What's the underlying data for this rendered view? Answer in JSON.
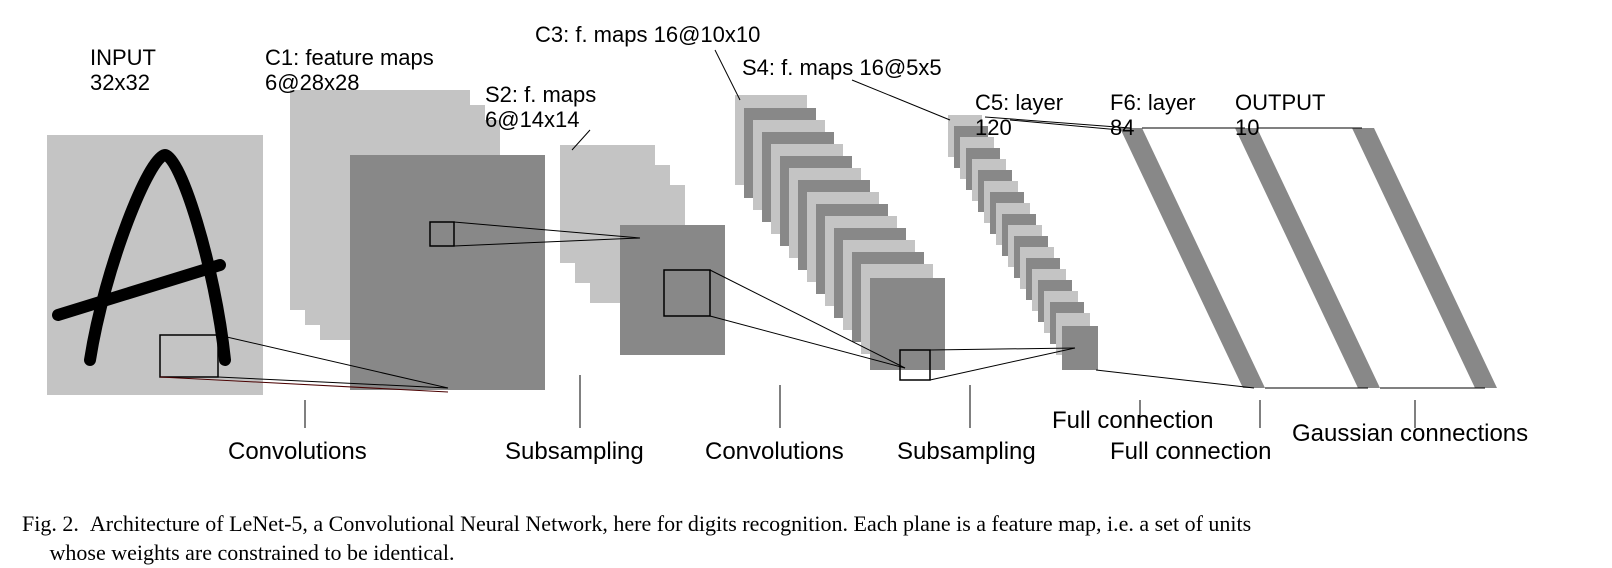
{
  "layers": {
    "input": {
      "title1": "INPUT",
      "title2": "32x32"
    },
    "c1": {
      "title1": "C1: feature maps",
      "title2": "6@28x28"
    },
    "s2": {
      "title1": "S2: f. maps",
      "title2": "6@14x14"
    },
    "c3": {
      "title1": "C3: f. maps 16@10x10",
      "title2": ""
    },
    "s4": {
      "title1": "S4: f. maps 16@5x5",
      "title2": ""
    },
    "c5": {
      "title1": "C5: layer",
      "title2": "120"
    },
    "f6": {
      "title1": "F6: layer",
      "title2": "84"
    },
    "output": {
      "title1": "OUTPUT",
      "title2": "10"
    }
  },
  "ops": {
    "conv1": "Convolutions",
    "sub1": "Subsampling",
    "conv2": "Convolutions",
    "sub2": "Subsampling",
    "full1": "Full connection",
    "full2": "Full connection",
    "gaussian": "Gaussian connections"
  },
  "caption_prefix": "Fig. 2.",
  "caption_line1": "Architecture of LeNet-5, a Convolutional Neural Network, here for digits recognition. Each plane is a feature map, i.e. a set of units",
  "caption_line2": "whose weights are constrained to be identical."
}
